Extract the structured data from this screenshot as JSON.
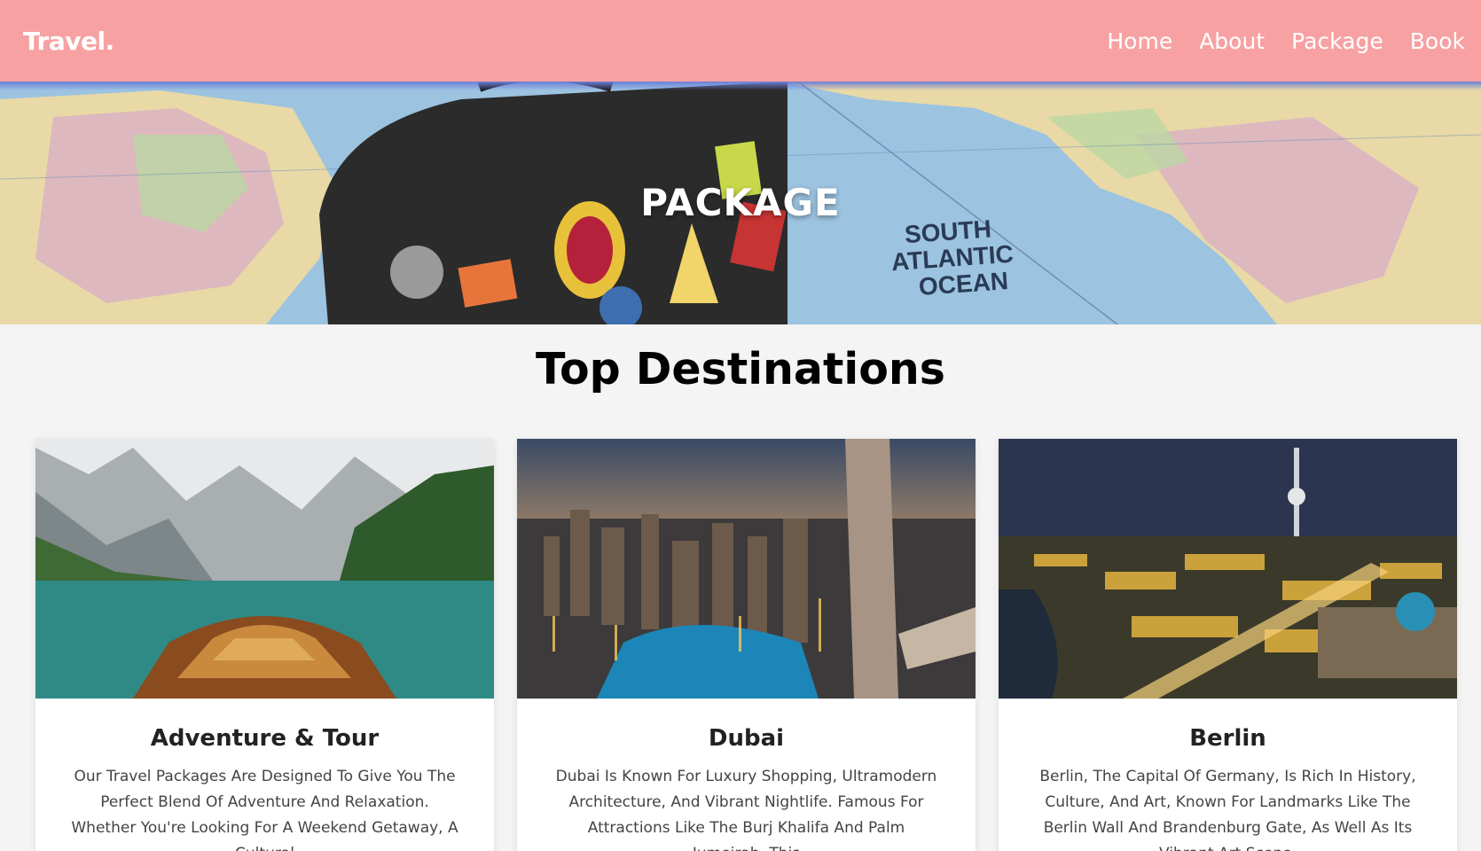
{
  "header": {
    "logo": "Travel.",
    "nav": [
      "Home",
      "About",
      "Package",
      "Book"
    ]
  },
  "hero": {
    "title": "PACKAGE",
    "map_labels": [
      "SOUTH",
      "ATLANTIC",
      "OCEAN"
    ]
  },
  "section": {
    "title": "Top Destinations"
  },
  "cards": [
    {
      "title": "Adventure & Tour",
      "text": "Our Travel Packages Are Designed To Give You The Perfect Blend Of Adventure And Relaxation. Whether You're Looking For A Weekend Getaway, A Cultural"
    },
    {
      "title": "Dubai",
      "text": "Dubai Is Known For Luxury Shopping, Ultramodern Architecture, And Vibrant Nightlife. Famous For Attractions Like The Burj Khalifa And Palm Jumeirah, This"
    },
    {
      "title": "Berlin",
      "text": "Berlin, The Capital Of Germany, Is Rich In History, Culture, And Art, Known For Landmarks Like The Berlin Wall And Brandenburg Gate, As Well As Its Vibrant Art Scene."
    }
  ]
}
